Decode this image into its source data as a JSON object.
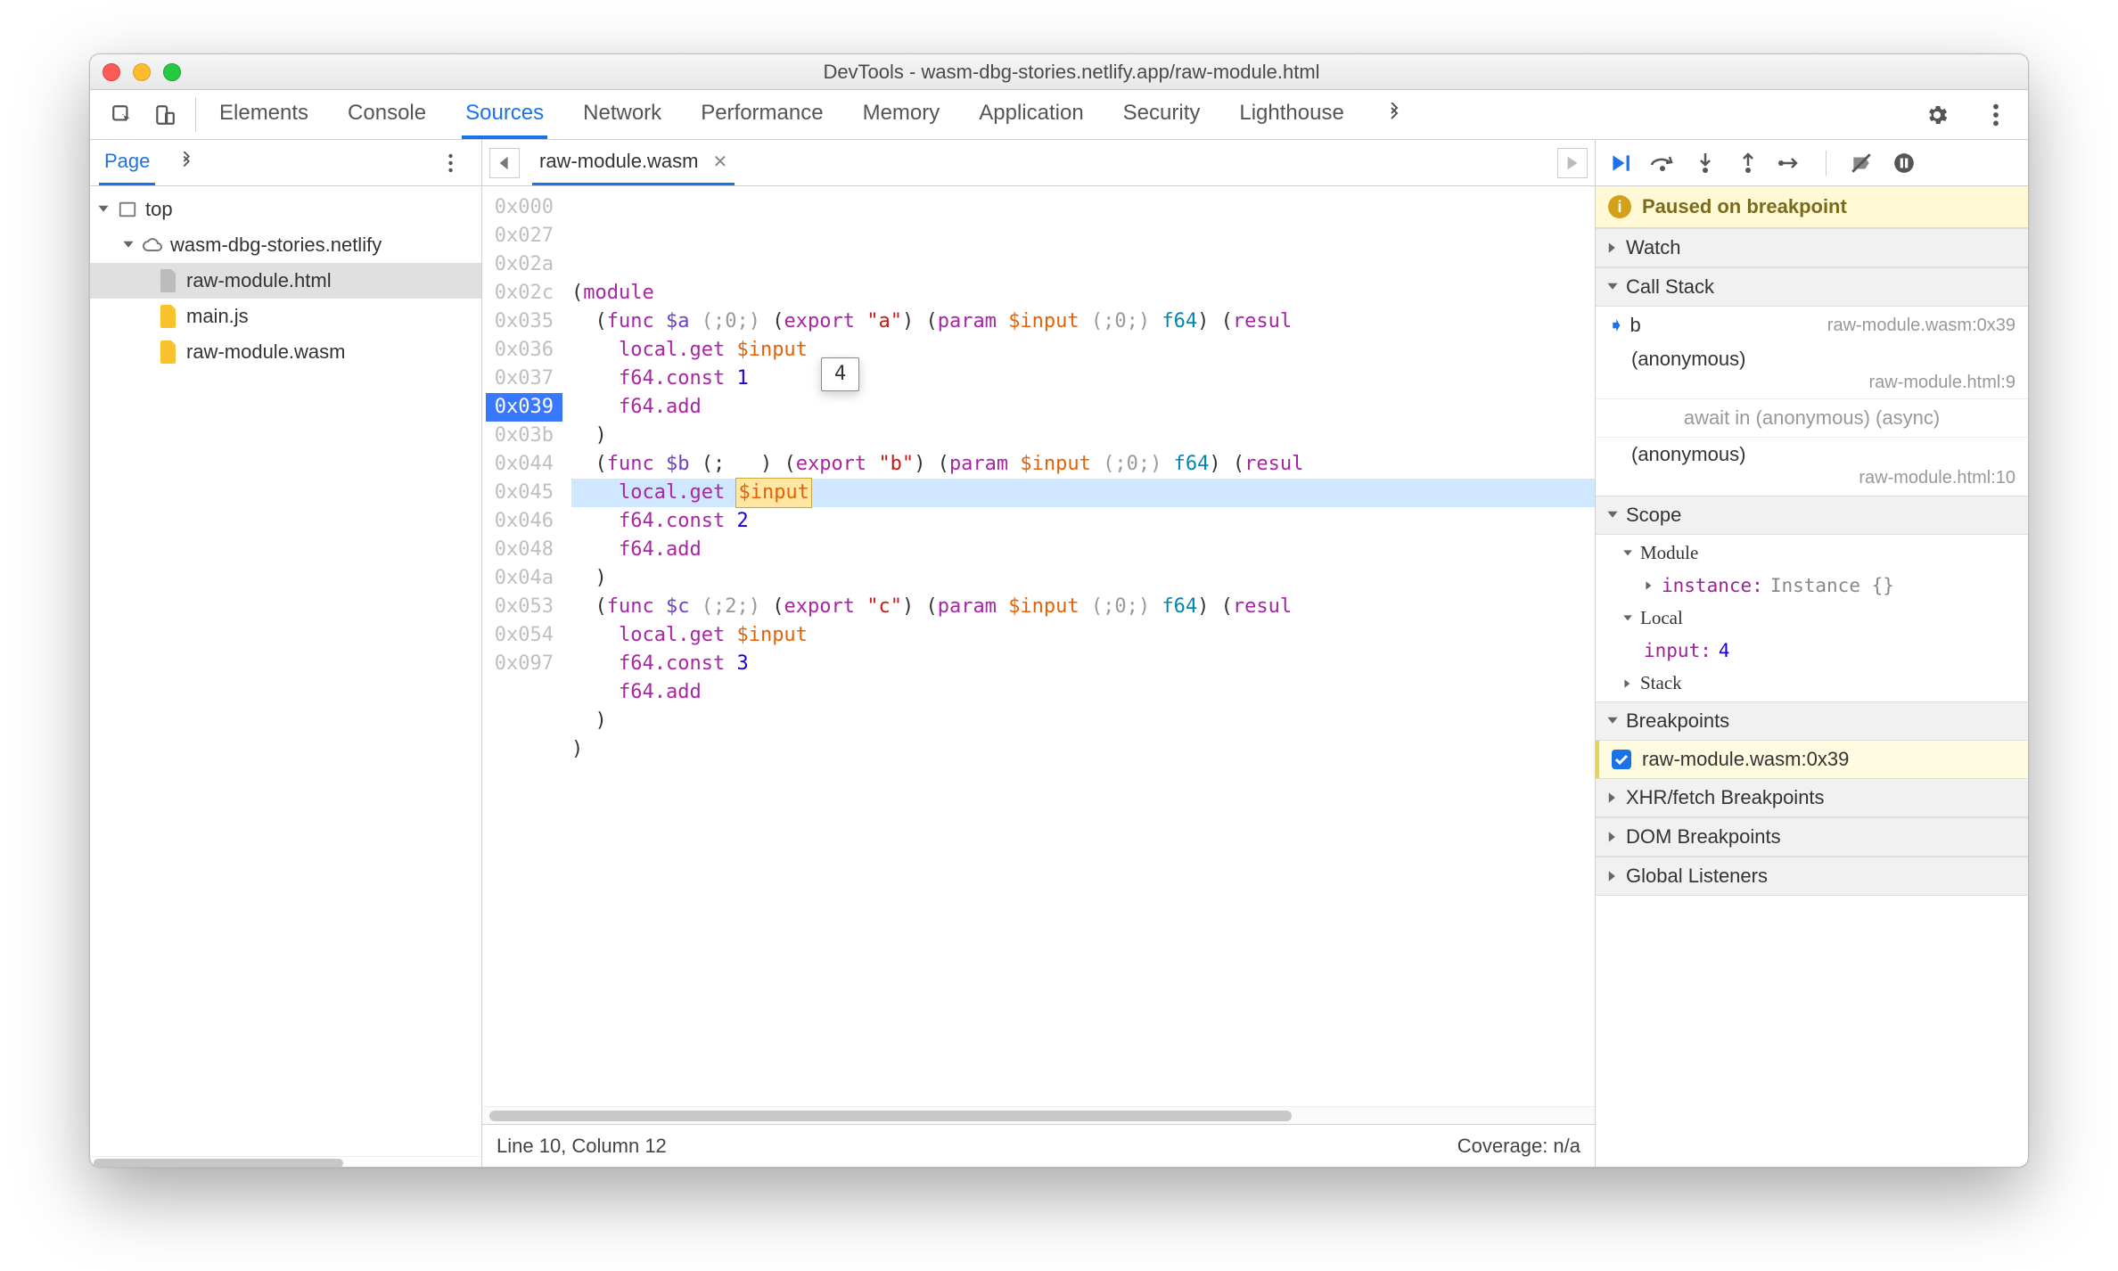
{
  "title": "DevTools - wasm-dbg-stories.netlify.app/raw-module.html",
  "tabs": {
    "elements": "Elements",
    "console": "Console",
    "sources": "Sources",
    "network": "Network",
    "performance": "Performance",
    "memory": "Memory",
    "application": "Application",
    "security": "Security",
    "lighthouse": "Lighthouse"
  },
  "navigator": {
    "page_tab": "Page",
    "tree": {
      "top": "top",
      "domain": "wasm-dbg-stories.netlify",
      "file_html": "raw-module.html",
      "file_js": "main.js",
      "file_wasm": "raw-module.wasm"
    }
  },
  "editor": {
    "tab_name": "raw-module.wasm",
    "gutter": [
      "0x000",
      "0x027",
      "0x02a",
      "0x02c",
      "0x035",
      "0x036",
      "0x037",
      "0x039",
      "0x03b",
      "0x044",
      "0x045",
      "0x046",
      "0x048",
      "0x04a",
      "0x053",
      "0x054",
      "0x097"
    ],
    "code": [
      [
        [
          "pln",
          "("
        ],
        [
          "kw",
          "module"
        ]
      ],
      [
        [
          "pln",
          "  ("
        ],
        [
          "kw",
          "func"
        ],
        [
          "pln",
          " "
        ],
        [
          "fn",
          "$a"
        ],
        [
          "pln",
          " "
        ],
        [
          "comment",
          "(;0;)"
        ],
        [
          "pln",
          " ("
        ],
        [
          "kw",
          "export"
        ],
        [
          "pln",
          " "
        ],
        [
          "str",
          "\"a\""
        ],
        [
          "pln",
          ") ("
        ],
        [
          "kw",
          "param"
        ],
        [
          "pln",
          " "
        ],
        [
          "var",
          "$input"
        ],
        [
          "pln",
          " "
        ],
        [
          "comment",
          "(;0;)"
        ],
        [
          "pln",
          " "
        ],
        [
          "type",
          "f64"
        ],
        [
          "pln",
          ") ("
        ],
        [
          "kw",
          "resul"
        ]
      ],
      [
        [
          "pln",
          "    "
        ],
        [
          "op",
          "local.get"
        ],
        [
          "pln",
          " "
        ],
        [
          "var",
          "$input"
        ]
      ],
      [
        [
          "pln",
          "    "
        ],
        [
          "op",
          "f64.const"
        ],
        [
          "pln",
          " "
        ],
        [
          "num",
          "1"
        ]
      ],
      [
        [
          "pln",
          "    "
        ],
        [
          "op",
          "f64.add"
        ]
      ],
      [
        [
          "pln",
          "  )"
        ]
      ],
      [
        [
          "pln",
          "  ("
        ],
        [
          "kw",
          "func"
        ],
        [
          "pln",
          " "
        ],
        [
          "fn",
          "$b"
        ],
        [
          "pln",
          " (;   ) ("
        ],
        [
          "kw",
          "export"
        ],
        [
          "pln",
          " "
        ],
        [
          "str",
          "\"b\""
        ],
        [
          "pln",
          ") ("
        ],
        [
          "kw",
          "param"
        ],
        [
          "pln",
          " "
        ],
        [
          "var",
          "$input"
        ],
        [
          "pln",
          " "
        ],
        [
          "comment",
          "(;0;)"
        ],
        [
          "pln",
          " "
        ],
        [
          "type",
          "f64"
        ],
        [
          "pln",
          ") ("
        ],
        [
          "kw",
          "resul"
        ]
      ],
      [
        [
          "pln",
          "    "
        ],
        [
          "op",
          "local.get"
        ],
        [
          "pln",
          " "
        ],
        [
          "var-hl",
          "$input"
        ]
      ],
      [
        [
          "pln",
          "    "
        ],
        [
          "op",
          "f64.const"
        ],
        [
          "pln",
          " "
        ],
        [
          "num",
          "2"
        ]
      ],
      [
        [
          "pln",
          "    "
        ],
        [
          "op",
          "f64.add"
        ]
      ],
      [
        [
          "pln",
          "  )"
        ]
      ],
      [
        [
          "pln",
          "  ("
        ],
        [
          "kw",
          "func"
        ],
        [
          "pln",
          " "
        ],
        [
          "fn",
          "$c"
        ],
        [
          "pln",
          " "
        ],
        [
          "comment",
          "(;2;)"
        ],
        [
          "pln",
          " ("
        ],
        [
          "kw",
          "export"
        ],
        [
          "pln",
          " "
        ],
        [
          "str",
          "\"c\""
        ],
        [
          "pln",
          ") ("
        ],
        [
          "kw",
          "param"
        ],
        [
          "pln",
          " "
        ],
        [
          "var",
          "$input"
        ],
        [
          "pln",
          " "
        ],
        [
          "comment",
          "(;0;)"
        ],
        [
          "pln",
          " "
        ],
        [
          "type",
          "f64"
        ],
        [
          "pln",
          ") ("
        ],
        [
          "kw",
          "resul"
        ]
      ],
      [
        [
          "pln",
          "    "
        ],
        [
          "op",
          "local.get"
        ],
        [
          "pln",
          " "
        ],
        [
          "var",
          "$input"
        ]
      ],
      [
        [
          "pln",
          "    "
        ],
        [
          "op",
          "f64.const"
        ],
        [
          "pln",
          " "
        ],
        [
          "num",
          "3"
        ]
      ],
      [
        [
          "pln",
          "    "
        ],
        [
          "op",
          "f64.add"
        ]
      ],
      [
        [
          "pln",
          "  )"
        ]
      ],
      [
        [
          "pln",
          ")"
        ]
      ]
    ],
    "highlight_index": 7,
    "tooltip": "4",
    "status_left": "Line 10, Column 12",
    "status_right": "Coverage: n/a"
  },
  "debugger": {
    "pause_msg": "Paused on breakpoint",
    "sections": {
      "watch": "Watch",
      "callstack": "Call Stack",
      "scope": "Scope",
      "breakpoints": "Breakpoints",
      "xhr": "XHR/fetch Breakpoints",
      "dom": "DOM Breakpoints",
      "global": "Global Listeners"
    },
    "callstack": [
      {
        "name": "b",
        "loc": "raw-module.wasm:0x39",
        "current": true
      },
      {
        "name": "(anonymous)",
        "loc": "raw-module.html:9"
      }
    ],
    "await_label": "await in (anonymous) (async)",
    "callstack2": [
      {
        "name": "(anonymous)",
        "loc": "raw-module.html:10"
      }
    ],
    "scope": {
      "module_label": "Module",
      "instance_key": "instance",
      "instance_val": "Instance {}",
      "local_label": "Local",
      "local_key": "input",
      "local_val": "4",
      "stack_label": "Stack"
    },
    "breakpoint_entry": "raw-module.wasm:0x39"
  }
}
